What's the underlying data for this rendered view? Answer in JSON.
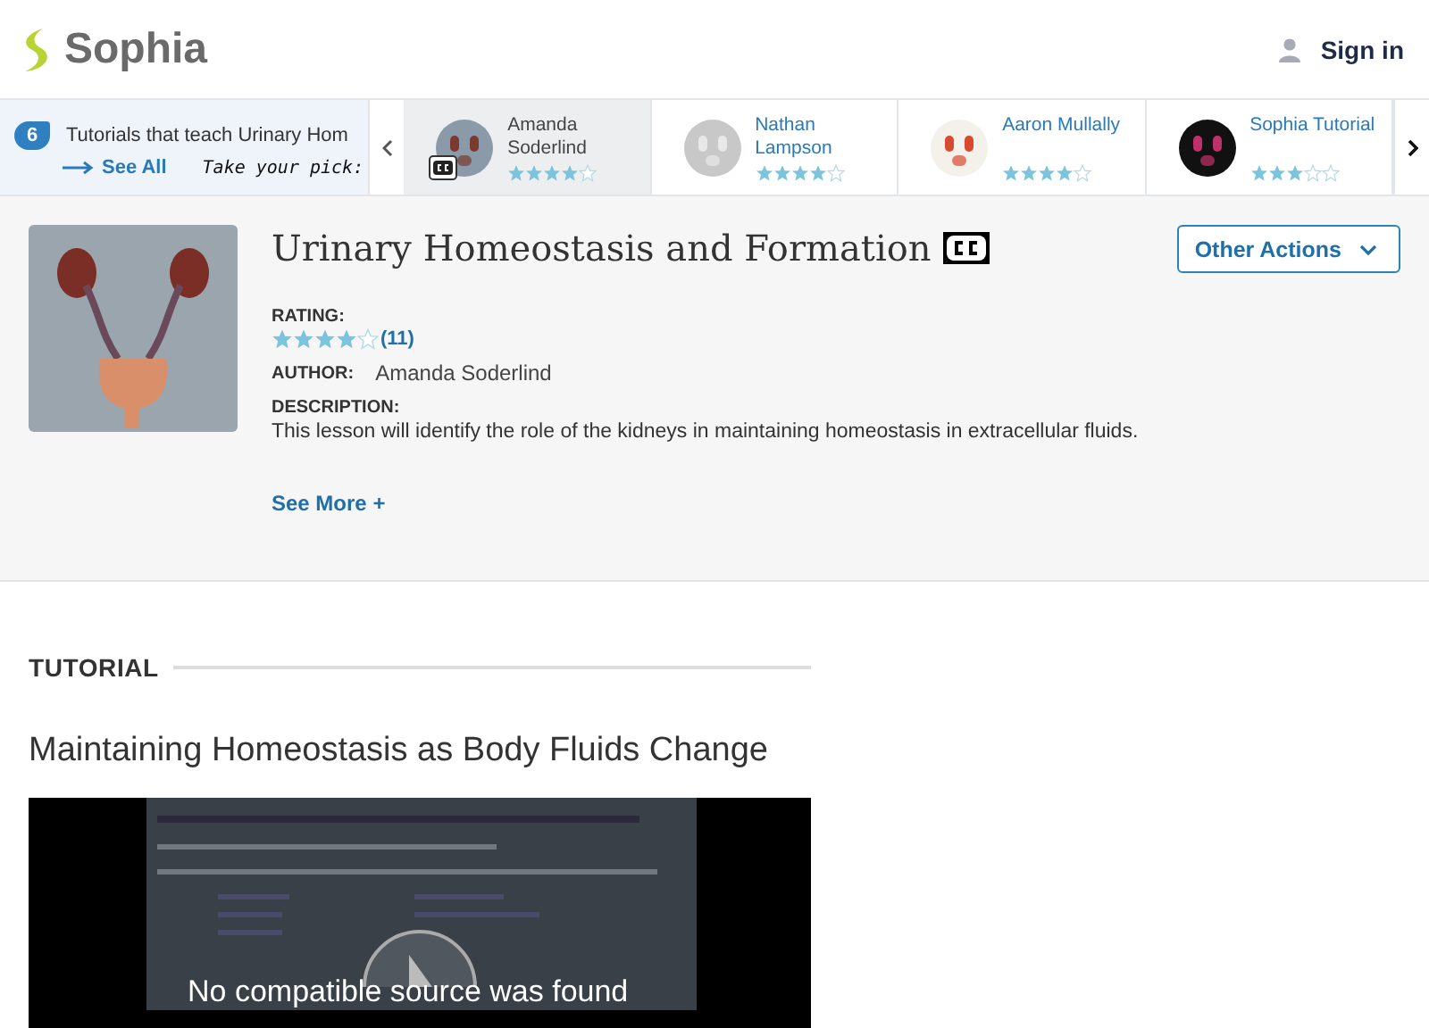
{
  "header": {
    "logo": "Sophia",
    "sign_in": "Sign in"
  },
  "carousel": {
    "count": "6",
    "title": "Tutorials that teach Urinary Hom",
    "see_all": "See All",
    "pick": "Take your pick:",
    "items": [
      {
        "name": "Amanda Soderlind",
        "stars": 4,
        "cc": true,
        "selected": true
      },
      {
        "name": "Nathan Lampson",
        "stars": 4,
        "cc": false,
        "selected": false
      },
      {
        "name": "Aaron Mullally",
        "stars": 4,
        "cc": false,
        "selected": false
      },
      {
        "name": "Sophia Tutorial",
        "stars": 3,
        "cc": false,
        "selected": false
      }
    ]
  },
  "lesson": {
    "title": "Urinary Homeostasis and Formation",
    "cc": true,
    "actions": "Other Actions",
    "rating_label": "RATING:",
    "stars": 4,
    "rating_count": "(11)",
    "author_label": "AUTHOR:",
    "author": "Amanda Soderlind",
    "description_label": "DESCRIPTION:",
    "description": "This lesson will identify the role of the kidneys in maintaining homeostasis in extracellular fluids.",
    "see_more": "See More +"
  },
  "tutorial": {
    "heading": "TUTORIAL",
    "title": "Maintaining Homeostasis as Body Fluids Change",
    "video_message": "No compatible source was found"
  }
}
